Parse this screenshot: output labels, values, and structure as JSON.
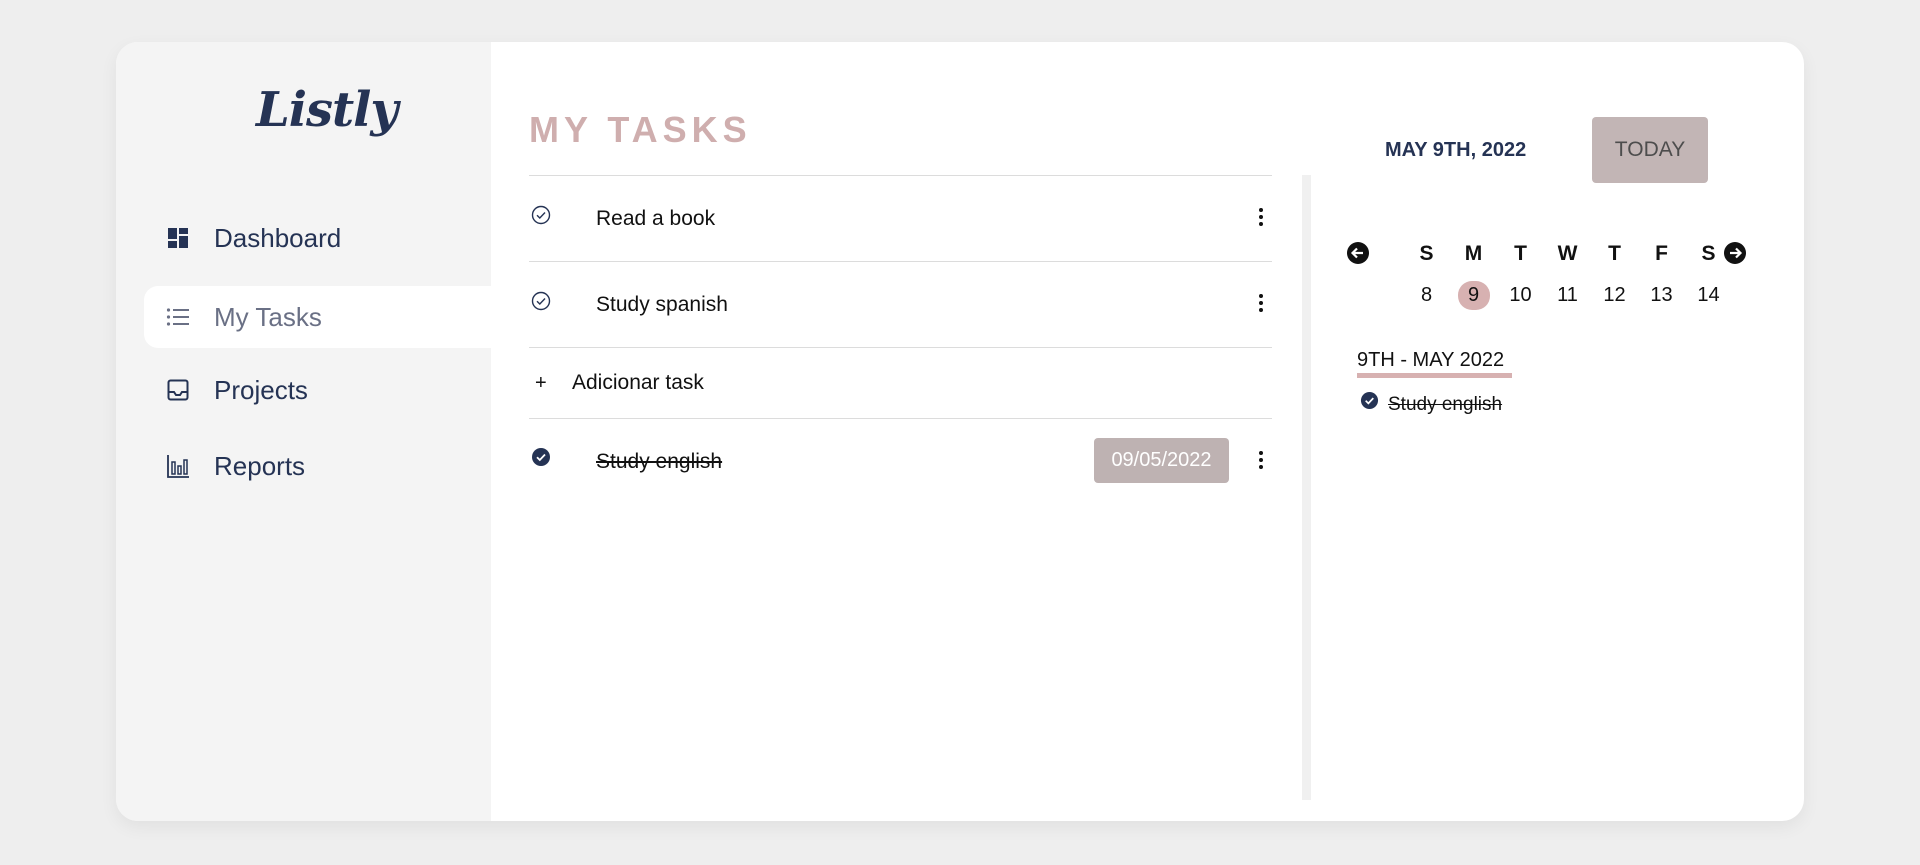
{
  "app": {
    "logo_text": "Listly"
  },
  "sidebar": {
    "items": [
      {
        "label": "Dashboard",
        "icon": "dashboard-icon",
        "active": false
      },
      {
        "label": "My Tasks",
        "icon": "list-icon",
        "active": true
      },
      {
        "label": "Projects",
        "icon": "inbox-icon",
        "active": false
      },
      {
        "label": "Reports",
        "icon": "bar-chart-icon",
        "active": false
      }
    ]
  },
  "main": {
    "title": "MY TASKS",
    "tasks": [
      {
        "label": "Read a book",
        "done": false
      },
      {
        "label": "Study spanish",
        "done": false
      }
    ],
    "add_task": {
      "plus": "+",
      "label": "Adicionar task"
    },
    "completed": [
      {
        "label": "Study english",
        "done": true,
        "date": "09/05/2022"
      }
    ]
  },
  "calendar": {
    "current_date": "MAY 9TH, 2022",
    "today_label": "TODAY",
    "weekdays": [
      "S",
      "M",
      "T",
      "W",
      "T",
      "F",
      "S"
    ],
    "dates": [
      "8",
      "9",
      "10",
      "11",
      "12",
      "13",
      "14"
    ],
    "selected_index": 1,
    "day_heading": "9TH - MAY 2022",
    "day_tasks": [
      {
        "label": "Study english",
        "done": true
      }
    ]
  },
  "colors": {
    "navy": "#253354",
    "accent_pink": "#d7b1b1",
    "title_pink": "#cfaeae",
    "chip_gray": "#beb2b2"
  }
}
